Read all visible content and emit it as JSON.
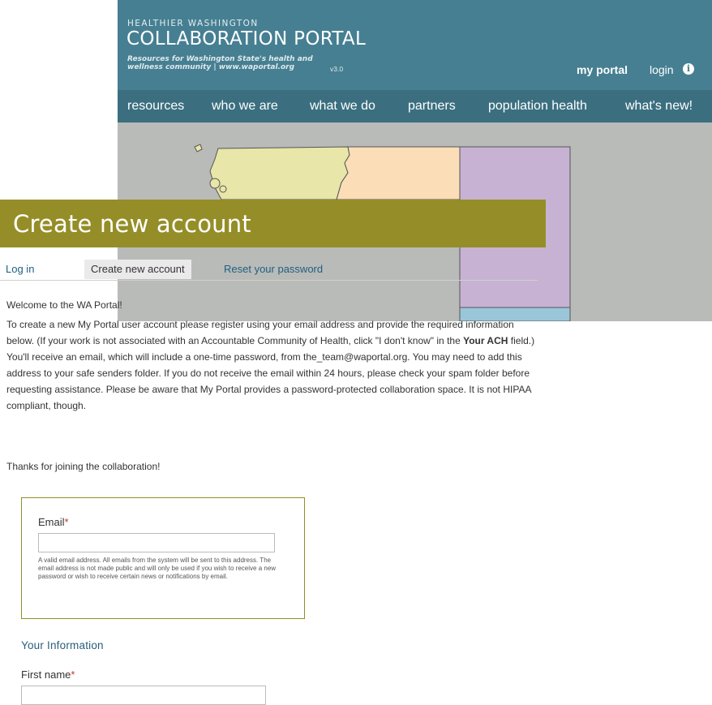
{
  "site": {
    "eyebrow": "HEALTHIER WASHINGTON",
    "title": "COLLABORATION PORTAL",
    "tagline": "Resources for Washington State's health and wellness community | www.waportal.org",
    "version": "v3.0",
    "my_portal": "my portal",
    "login": "login",
    "info_icon": "info-icon",
    "nav": [
      "resources",
      "who we are",
      "what we do",
      "partners",
      "population health",
      "what's new!"
    ],
    "colors": {
      "header": "#467f92",
      "nav": "#3b6f80",
      "accent": "#958e28"
    }
  },
  "page": {
    "title": "Create new account",
    "tabs": [
      {
        "label": "Log in",
        "active": false
      },
      {
        "label": "Create new account",
        "active": true
      },
      {
        "label": "Reset your password",
        "active": false
      }
    ],
    "welcome": "Welcome to the WA Portal!",
    "intro_1": "To create a new My Portal user account please register using your email address and provide the required information below. (If your work is not associated with an Accountable Community of Health, click \"I don't know\" in the ",
    "intro_bold": "Your ACH",
    "intro_2": " field.) You'll receive an email, which will include a one-time password, from the_team@waportal.org.  You may need to add this address to your safe senders folder. If you do not receive the email within 24 hours,  please check your spam folder before requesting assistance. Please be aware that My Portal provides a password-protected collaboration space. It is not HIPAA compliant, though.",
    "thanks": "Thanks for joining the collaboration!"
  },
  "form": {
    "email_label": "Email",
    "required_mark": "*",
    "email_value": "",
    "email_help": "A valid email address. All emails from the system will be sent to this address. The email address is not made public and will only be used if you wish to receive a new password or wish to receive certain news or notifications by email.",
    "section_title": "Your Information",
    "first_name_label": "First name",
    "first_name_value": ""
  }
}
